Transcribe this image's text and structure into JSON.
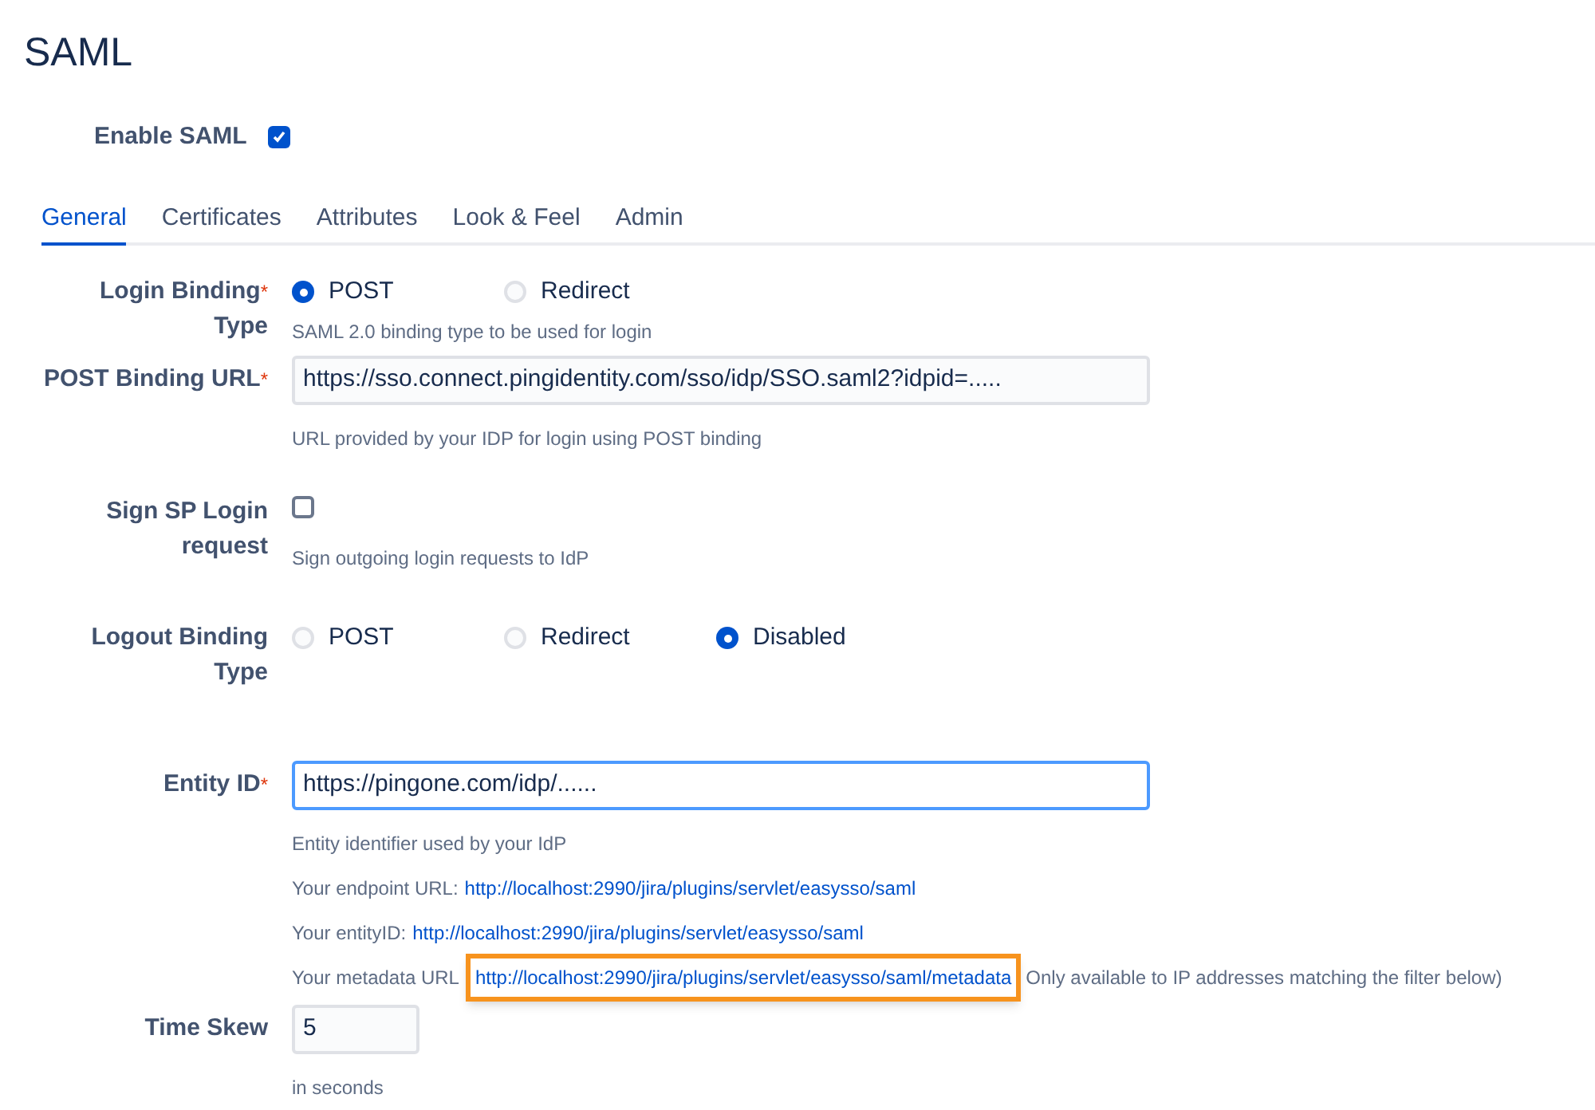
{
  "title": "SAML",
  "enable": {
    "label": "Enable SAML",
    "checked": true
  },
  "tabs": [
    {
      "label": "General",
      "selected": true
    },
    {
      "label": "Certificates",
      "selected": false
    },
    {
      "label": "Attributes",
      "selected": false
    },
    {
      "label": "Look & Feel",
      "selected": false
    },
    {
      "label": "Admin",
      "selected": false
    }
  ],
  "fields": [
    {
      "kind": "radio",
      "label": "Login Binding",
      "label_2": "Type",
      "required_mark": "*",
      "options": [
        {
          "label": "POST",
          "selected": true
        },
        {
          "label": "Redirect",
          "selected": false
        }
      ],
      "help": "SAML 2.0 binding type to be used for login"
    },
    {
      "kind": "text",
      "label": "POST Binding URL",
      "required_mark": "*",
      "value": "https://sso.connect.pingidentity.com/sso/idp/SSO.saml2?idpid=.....",
      "focused": false,
      "help": "URL provided by your IDP for login using POST binding"
    },
    {
      "kind": "checkbox",
      "label": "Sign SP Login",
      "label_2": "request",
      "checked": false,
      "help": "Sign outgoing login requests to IdP"
    },
    {
      "kind": "radio",
      "label": "Logout Binding",
      "label_2": "Type",
      "options": [
        {
          "label": "POST",
          "selected": false
        },
        {
          "label": "Redirect",
          "selected": false
        },
        {
          "label": "Disabled",
          "selected": true
        }
      ]
    },
    {
      "kind": "text",
      "label": "Entity ID",
      "required_mark": "*",
      "value": "https://pingone.com/idp/......",
      "focused": true,
      "help": "Entity identifier used by your IdP",
      "info": [
        {
          "prefix": "Your endpoint URL:",
          "link": "http://localhost:2990/jira/plugins/servlet/easysso/saml",
          "highlighted": false
        },
        {
          "prefix": "Your entityID:",
          "link": "http://localhost:2990/jira/plugins/servlet/easysso/saml",
          "highlighted": false
        },
        {
          "prefix": "Your metadata URL",
          "link": "http://localhost:2990/jira/plugins/servlet/easysso/saml/metadata",
          "highlighted": true,
          "note": "Only available to IP addresses matching the filter below)"
        }
      ]
    },
    {
      "kind": "short",
      "label": "Time Skew",
      "value": "5",
      "focused": false,
      "help": "in seconds"
    }
  ]
}
